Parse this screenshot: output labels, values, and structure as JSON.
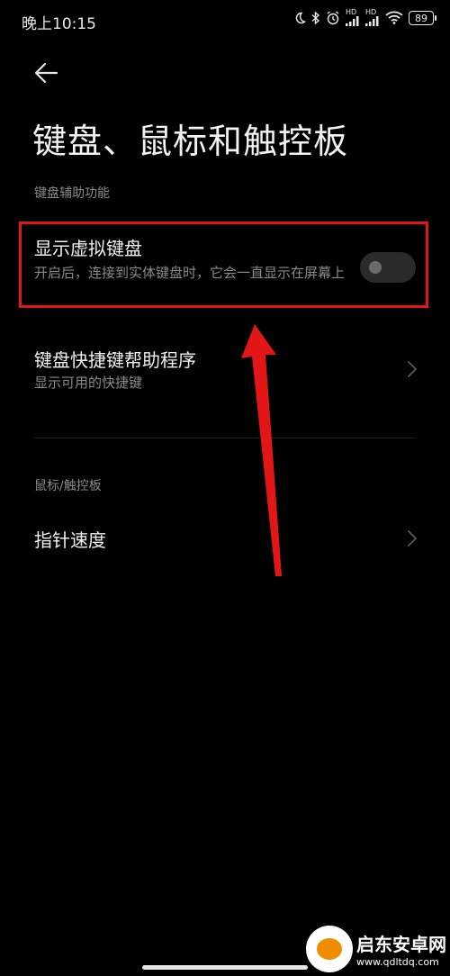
{
  "status_bar": {
    "time": "晚上10:15",
    "battery": "89",
    "hd_label": "HD",
    "icons": [
      "moon-icon",
      "bluetooth-icon",
      "alarm-icon",
      "signal-icon",
      "signal-icon",
      "wifi-icon",
      "battery-icon"
    ]
  },
  "header": {
    "back_icon": "back-arrow-icon",
    "title": "键盘、鼠标和触控板"
  },
  "sections": {
    "keyboard": {
      "header": "键盘辅助功能",
      "virtual_keyboard": {
        "title": "显示虚拟键盘",
        "subtitle": "开启后，连接到实体键盘时，它会一直显示在屏幕上",
        "enabled": false
      },
      "shortcut_helper": {
        "title": "键盘快捷键帮助程序",
        "subtitle": "显示可用的快捷键",
        "icon": "chevron-right-icon"
      }
    },
    "mouse": {
      "header": "鼠标/触控板",
      "pointer_speed": {
        "title": "指针速度",
        "icon": "chevron-right-icon"
      }
    }
  },
  "annotation": {
    "highlight_color": "#e21616"
  },
  "watermark": {
    "name": "启东安卓网",
    "url": "www.qdltdq.com"
  }
}
